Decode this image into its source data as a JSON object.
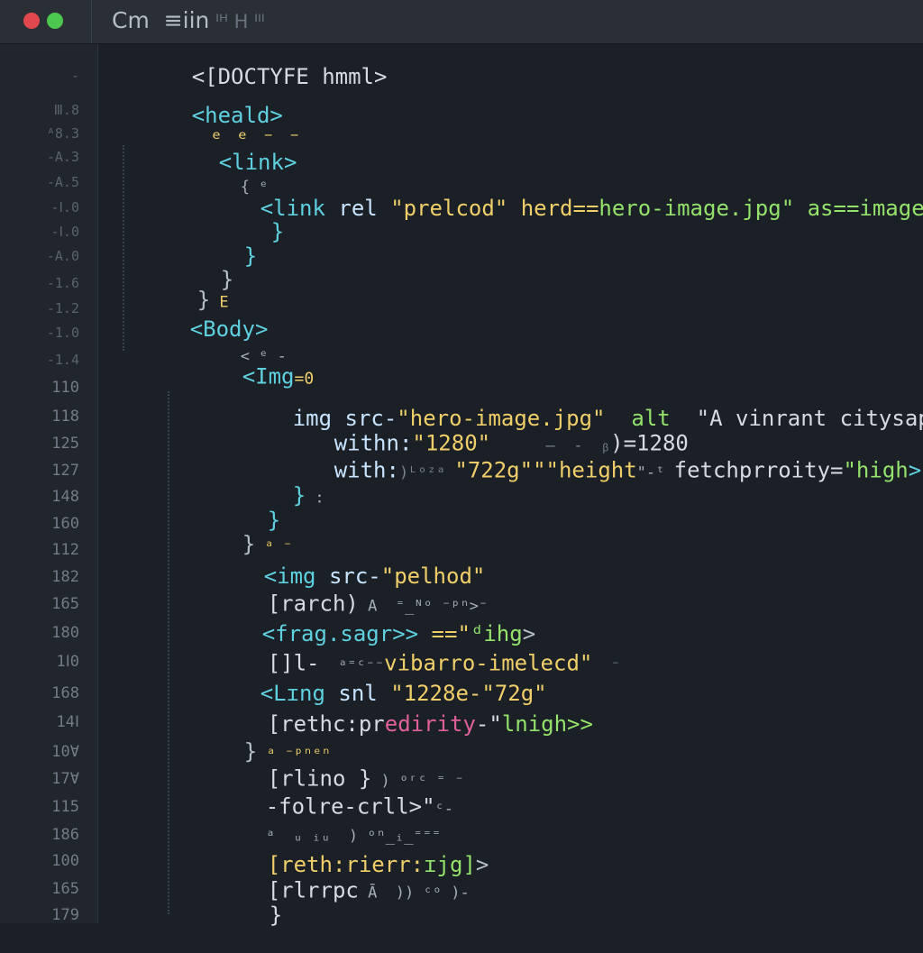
{
  "window": {
    "title": "Cm",
    "title_extra": "≡iin",
    "title_dim": " ᴵᴴ H ᴵᴵᴵ"
  },
  "gutter": {
    "line_numbers": [
      "-",
      "Ⅲ.8",
      "ᴬ8.3",
      "-A.3",
      "-A.5",
      "-Ⅰ.0",
      "-Ⅰ.0",
      "-A.0",
      "-1.6",
      "-1.2",
      "-1.0",
      "-1.4",
      "110",
      "118",
      "125",
      "127",
      "148",
      "160",
      "112",
      "182",
      "165",
      "180",
      "1Ⅰ0",
      "168",
      "14Ⅰ",
      "10Ɐ",
      "17Ɐ",
      "115",
      "186",
      "100",
      "165",
      "179"
    ]
  },
  "code": {
    "l1": {
      "text": "<[DOCTYFE hmml>"
    },
    "l2": {
      "tag": "<heald>"
    },
    "l3": {
      "marks": "ᵉ ᵉ ⁻ ⁻"
    },
    "l4": {
      "tag": "<link>"
    },
    "l5": {
      "marks": "{ ᵉ"
    },
    "l6": {
      "open": "<link",
      "attr": " rel ",
      "val1": "\"prelcod\"",
      "attr2": " herd==",
      "val2": "hero-image.jpg\"",
      "attr3": " as==",
      "val3": "image",
      "close": ">"
    },
    "l7": {
      "brace": "}"
    },
    "l8": {
      "brace": "}"
    },
    "l9": {
      "brace": "}"
    },
    "l10": {
      "brace": "}",
      "mark": " E"
    },
    "l11": {
      "tag": "<Body>"
    },
    "l12": {
      "marks": "< ᵉ -"
    },
    "l13": {
      "tag": "<Img",
      "mark": "=0"
    },
    "l14": {
      "attr": "img src-",
      "val": "\"hero-image.jpg\"",
      "attr2": "  alt  ",
      "val2": "\"A vinrant citysape\""
    },
    "l15": {
      "attr": "withn:",
      "val": "\"1280\"",
      "mid": "      —  -  ᵦ",
      "val2": ")=1280"
    },
    "l16": {
      "attr": "with:",
      "mid": ")ᴸᵒᶻᵃ ",
      "val": "\"722g\"\"\"",
      "attr2": "height",
      "mid2": "\"-ᵗ ",
      "attr3": "fetchprroity=",
      "val3": "\"high",
      "close": ">"
    },
    "l17": {
      "brace": "}",
      "mark": " :"
    },
    "l18": {
      "brace": "}"
    },
    "l19": {
      "brace": "}",
      "mark": " ᵃ ⁻"
    },
    "l20": {
      "tag": "<img",
      "attr": " src-",
      "val": "\"pelhod\""
    },
    "l21": {
      "text": "[rarch)",
      "dim": " A  ⁼_ᴺᵒ ⁻ᵖⁿ>⁻"
    },
    "l22": {
      "tag": "<frag.sagr>>",
      "val": " ==\"",
      "grn": "ᵈihg",
      "close": ">"
    },
    "l23": {
      "text": "[]l-",
      "dim": "  ᵃ⁼ᶜ⁻⁻",
      "val": "vibarro-imelecd\"",
      "dim2": "  ⁻"
    },
    "l24": {
      "tag": "<Lɪng",
      "attr": " snl ",
      "val": "\"1228e-\"72g\""
    },
    "l25": {
      "text": "[rethc:pr",
      "pink": "edirity",
      "val": "-\"",
      "grn": "lnigh>>"
    },
    "l26": {
      "brace": "}",
      "mark": " ᵃ ⁻ᵖⁿᵉⁿ"
    },
    "l27": {
      "text": "[rlino }",
      "dim": " ) ᵒʳᶜ ⁼ ⁻"
    },
    "l28": {
      "text": "-folre-crll>\"",
      "dim": "ᶜ-"
    },
    "l29": {
      "marks": "ᵃ  ᵤ ᵢᵤ  ) ᵒⁿ_ᵢ_⁼⁼⁼"
    },
    "l30": {
      "val": "[reth:rierr:",
      "grn": "ɪjg]",
      "close": ">"
    },
    "l31": {
      "text": "[rlrrpc",
      "dim": " Ā  )) ᶜᵒ )-"
    },
    "l32": {
      "brace": "}"
    }
  }
}
